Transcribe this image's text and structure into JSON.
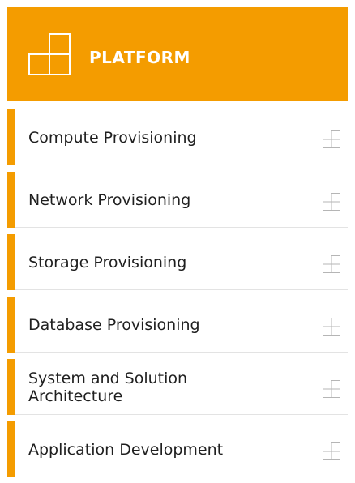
{
  "header": {
    "title": "PLATFORM",
    "icon": "blocks-icon",
    "background_color": "#f49c00",
    "text_color": "#ffffff"
  },
  "menu": {
    "accent_color": "#f49c00",
    "item_icon": "blocks-icon",
    "items": [
      {
        "label": "Compute Provisioning",
        "name": "compute-provisioning"
      },
      {
        "label": "Network Provisioning",
        "name": "network-provisioning"
      },
      {
        "label": "Storage Provisioning",
        "name": "storage-provisioning"
      },
      {
        "label": "Database Provisioning",
        "name": "database-provisioning"
      },
      {
        "label": "System and Solution Architecture",
        "name": "system-and-solution-architecture"
      },
      {
        "label": "Application Development",
        "name": "application-development"
      }
    ]
  }
}
